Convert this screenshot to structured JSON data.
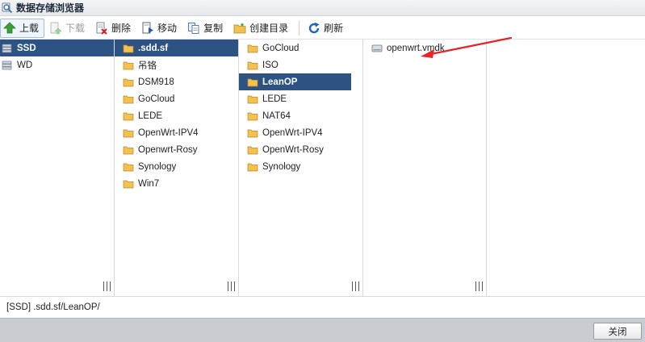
{
  "window": {
    "title": "数据存储浏览器"
  },
  "toolbar": {
    "upload": "上载",
    "download": "下载",
    "delete": "删除",
    "move": "移动",
    "copy": "复制",
    "create_dir": "创建目录",
    "refresh": "刷新"
  },
  "columns": [
    {
      "items": [
        {
          "label": "SSD",
          "selected": true
        },
        {
          "label": "WD",
          "selected": false
        }
      ]
    },
    {
      "items": [
        {
          "label": ".sdd.sf",
          "selected": true
        },
        {
          "label": "吊铬",
          "selected": false
        },
        {
          "label": "DSM918",
          "selected": false
        },
        {
          "label": "GoCloud",
          "selected": false
        },
        {
          "label": "LEDE",
          "selected": false
        },
        {
          "label": "OpenWrt-IPV4",
          "selected": false
        },
        {
          "label": "Openwrt-Rosy",
          "selected": false
        },
        {
          "label": "Synology",
          "selected": false
        },
        {
          "label": "Win7",
          "selected": false
        }
      ]
    },
    {
      "items": [
        {
          "label": "GoCloud",
          "selected": false
        },
        {
          "label": "ISO",
          "selected": false
        },
        {
          "label": "LeanOP",
          "selected": true
        },
        {
          "label": "LEDE",
          "selected": false
        },
        {
          "label": "NAT64",
          "selected": false
        },
        {
          "label": "OpenWrt-IPV4",
          "selected": false
        },
        {
          "label": "OpenWrt-Rosy",
          "selected": false
        },
        {
          "label": "Synology",
          "selected": false
        }
      ]
    },
    {
      "items": [
        {
          "label": "openwrt.vmdk",
          "selected": false
        }
      ]
    }
  ],
  "status": {
    "path": "[SSD] .sdd.sf/LeanOP/"
  },
  "footer": {
    "close": "关闭"
  },
  "colors": {
    "selection": "#2c5383",
    "folder": "#f2c14e",
    "arrow": "#e8242b"
  }
}
